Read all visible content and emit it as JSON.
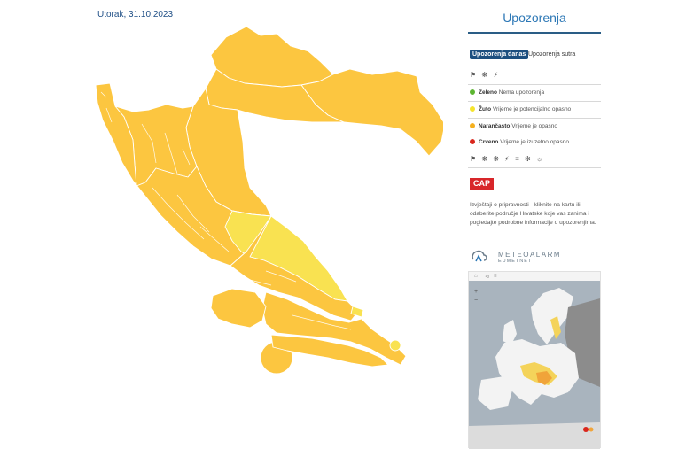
{
  "date": "Utorak, 31.10.2023",
  "panel": {
    "title": "Upozorenja",
    "tab_today": "Upozorenja danas",
    "tab_tomorrow": "Upozorenja sutra",
    "hazard_icons_1": "⚑ ❋ ⚡",
    "legend": [
      {
        "level": "Zeleno",
        "text": "Nema upozorenja",
        "color": "#5cb531"
      },
      {
        "level": "Žuto",
        "text": "Vrijeme je potencijalno opasno",
        "color": "#f5e42c"
      },
      {
        "level": "Narančasto",
        "text": "Vrijeme je opasno",
        "color": "#f5b01e"
      },
      {
        "level": "Crveno",
        "text": "Vrijeme je izuzetno opasno",
        "color": "#d9261c"
      }
    ],
    "hazard_icons_2": "⚑ ❋ ❋ ⚡ ≡ ✻ ☼",
    "cap_label": "CAP",
    "info_text": "Izvještaji o pripravnosti - kliknite na kartu ili odaberite područje Hrvatske koje vas zanima i pogledajte podrobne informacije o upozorenjima.",
    "meteoalarm_title": "METEOALARM",
    "meteoalarm_sub": "EUMETNET"
  },
  "colors": {
    "region_orange": "#fcc640",
    "region_yellow": "#f9e251",
    "sea": "#a9b4be",
    "land_grey": "#8c8c8c"
  }
}
